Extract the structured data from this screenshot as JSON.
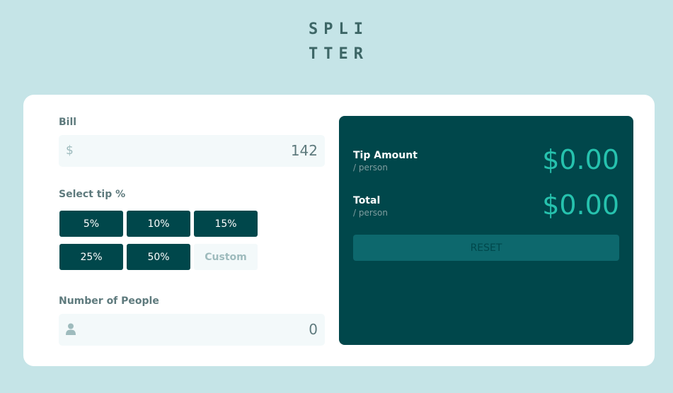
{
  "app": {
    "logo_line1": "SPLI",
    "logo_line2": "TTER"
  },
  "bill": {
    "label": "Bill",
    "currency_symbol": "$",
    "value": "142"
  },
  "tip": {
    "label": "Select tip %",
    "options": [
      "5%",
      "10%",
      "15%",
      "25%",
      "50%"
    ],
    "custom_placeholder": "Custom"
  },
  "people": {
    "label": "Number of People",
    "icon": "person-icon",
    "value": "0"
  },
  "results": {
    "tip_amount": {
      "title": "Tip Amount",
      "subtitle": "/ person",
      "value": "$0.00"
    },
    "total": {
      "title": "Total",
      "subtitle": "/ person",
      "value": "$0.00"
    },
    "reset_label": "RESET"
  },
  "colors": {
    "background": "#c5e4e7",
    "dark_cyan": "#00474b",
    "accent_cyan": "#26c2ae",
    "reset_disabled": "#0d686d"
  }
}
